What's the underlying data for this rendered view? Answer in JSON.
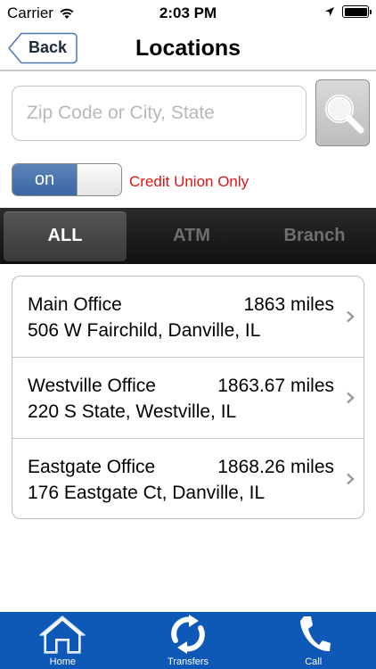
{
  "status_bar": {
    "carrier": "Carrier",
    "time": "2:03 PM"
  },
  "nav": {
    "back_label": "Back",
    "title": "Locations"
  },
  "search": {
    "placeholder": "Zip Code or City, State",
    "value": ""
  },
  "toggle": {
    "state_label": "on",
    "label": "Credit Union Only"
  },
  "segments": [
    {
      "label": "ALL",
      "active": true
    },
    {
      "label": "ATM",
      "active": false
    },
    {
      "label": "Branch",
      "active": false
    }
  ],
  "locations": [
    {
      "name": "Main Office",
      "distance": "1863 miles",
      "address": "506 W Fairchild, Danville, IL"
    },
    {
      "name": "Westville Office",
      "distance": "1863.67 miles",
      "address": "220 S State, Westville, IL"
    },
    {
      "name": "Eastgate Office",
      "distance": "1868.26 miles",
      "address": "176 Eastgate Ct, Danville, IL"
    }
  ],
  "tabs": [
    {
      "label": "Home",
      "icon": "home-icon"
    },
    {
      "label": "Transfers",
      "icon": "transfers-icon"
    },
    {
      "label": "Call",
      "icon": "phone-icon"
    }
  ],
  "colors": {
    "tab_bar": "#0e58b8",
    "toggle_on": "#3b66a5",
    "credit_union_label": "#e01414"
  }
}
